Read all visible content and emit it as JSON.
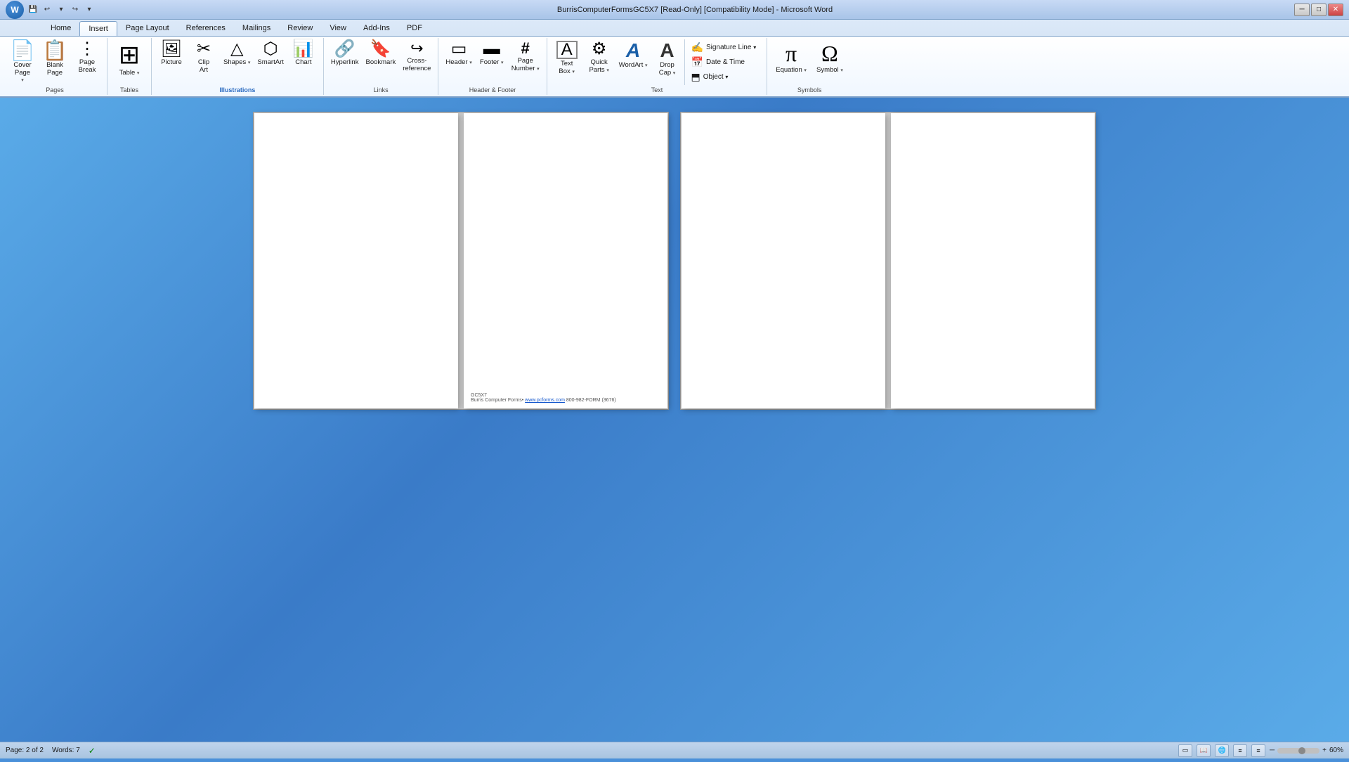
{
  "titlebar": {
    "title": "BurrisComputerFormsGC5X7 [Read-Only] [Compatibility Mode] - Microsoft Word",
    "minimize": "─",
    "restore": "□",
    "close": "✕"
  },
  "qat": {
    "save": "💾",
    "undo": "↩",
    "redo": "↪",
    "dropdown": "▾"
  },
  "tabs": [
    {
      "label": "Home",
      "active": false
    },
    {
      "label": "Insert",
      "active": true
    },
    {
      "label": "Page Layout",
      "active": false
    },
    {
      "label": "References",
      "active": false
    },
    {
      "label": "Mailings",
      "active": false
    },
    {
      "label": "Review",
      "active": false
    },
    {
      "label": "View",
      "active": false
    },
    {
      "label": "Add-Ins",
      "active": false
    },
    {
      "label": "PDF",
      "active": false
    }
  ],
  "ribbon": {
    "groups": [
      {
        "name": "Pages",
        "label": "Pages",
        "items": [
          {
            "id": "cover-page",
            "label": "Cover\nPage",
            "icon": "📄",
            "dropdown": true
          },
          {
            "id": "blank-page",
            "label": "Blank\nPage",
            "icon": "📋"
          },
          {
            "id": "page-break",
            "label": "Page\nBreak",
            "icon": "⋮"
          }
        ]
      },
      {
        "name": "Tables",
        "label": "Tables",
        "items": [
          {
            "id": "table",
            "label": "Table",
            "icon": "⊞",
            "dropdown": true
          }
        ]
      },
      {
        "name": "Illustrations",
        "label": "Illustrations",
        "items": [
          {
            "id": "picture",
            "label": "Picture",
            "icon": "🖼"
          },
          {
            "id": "clip-art",
            "label": "Clip\nArt",
            "icon": "✂"
          },
          {
            "id": "shapes",
            "label": "Shapes",
            "icon": "△",
            "dropdown": true
          },
          {
            "id": "smartart",
            "label": "SmartArt",
            "icon": "⬡"
          },
          {
            "id": "chart",
            "label": "Chart",
            "icon": "📊"
          }
        ]
      },
      {
        "name": "Links",
        "label": "Links",
        "items": [
          {
            "id": "hyperlink",
            "label": "Hyperlink",
            "icon": "🔗"
          },
          {
            "id": "bookmark",
            "label": "Bookmark",
            "icon": "🔖"
          },
          {
            "id": "cross-reference",
            "label": "Cross-\nreference",
            "icon": "↪"
          }
        ]
      },
      {
        "name": "HeaderFooter",
        "label": "Header & Footer",
        "items": [
          {
            "id": "header",
            "label": "Header",
            "icon": "▭",
            "dropdown": true
          },
          {
            "id": "footer",
            "label": "Footer",
            "icon": "▬",
            "dropdown": true
          },
          {
            "id": "page-number",
            "label": "Page\nNumber",
            "icon": "#⃣",
            "dropdown": true
          }
        ]
      },
      {
        "name": "Text",
        "label": "Text",
        "items": [
          {
            "id": "text-box",
            "label": "Text\nBox",
            "icon": "☐",
            "dropdown": true
          },
          {
            "id": "quick-parts",
            "label": "Quick\nParts",
            "icon": "⚙",
            "dropdown": true
          },
          {
            "id": "wordart",
            "label": "WordArt",
            "icon": "A",
            "dropdown": true
          },
          {
            "id": "drop-cap",
            "label": "Drop\nCap",
            "icon": "A",
            "dropdown": true
          }
        ]
      },
      {
        "name": "Symbols",
        "label": "Symbols",
        "items": [
          {
            "id": "equation",
            "label": "Equation",
            "icon": "π",
            "dropdown": true
          },
          {
            "id": "symbol",
            "label": "Symbol",
            "icon": "Ω",
            "dropdown": true
          }
        ]
      }
    ],
    "rightSection": {
      "items": [
        {
          "id": "signature-line",
          "label": "Signature Line",
          "icon": "✍",
          "dropdown": true
        },
        {
          "id": "date-time",
          "label": "Date & Time",
          "icon": "📅"
        },
        {
          "id": "object",
          "label": "Object",
          "icon": "⬒",
          "dropdown": true
        }
      ]
    }
  },
  "document": {
    "pages": [
      {
        "id": "page1-left",
        "hasFooter": false,
        "footerText": ""
      },
      {
        "id": "page1-right",
        "hasFooter": true,
        "footerLine1": "GC5X7",
        "footerLine2": "Burris Computer Forms• www.pcforms.com  800-982-FORM (3676)"
      },
      {
        "id": "page2-left",
        "hasFooter": false,
        "footerText": ""
      },
      {
        "id": "page2-right",
        "hasFooter": false,
        "footerText": ""
      }
    ]
  },
  "statusbar": {
    "page": "Page: 2 of 2",
    "words": "Words: 7",
    "zoom": "60%"
  }
}
